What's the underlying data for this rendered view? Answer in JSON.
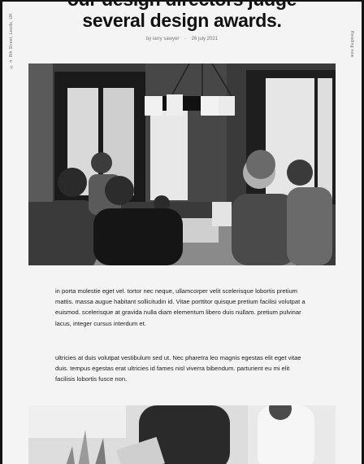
{
  "sidebar_left": "© n. 8th Street, Leeds, UK",
  "sidebar_right": "Reading now",
  "article": {
    "title_line1": "our design directors judge",
    "title_line2": "several design awards.",
    "byline_prefix": "by",
    "author": "larry sawyer",
    "separator": "-",
    "date": "26 july 2021",
    "paragraph1": "in porta molestie eget vel. tortor nec neque, ullamcorper velit scelerisque lobortis pretium mattis. massa augue habitant sollicitudin id. Vitae porttitor quisque pretium facilisi volutpat a euismod. scelerisque at gravida nulla diam elementum libero duis nullam. pretium pulvinar lacus, integer cursus interdum et.",
    "paragraph2": "ultricies at duis volutpat vestibulum sed ut. Nec pharetra leo magnis egestas elit eget vitae duis. tempus egestas erat ultricies id fames nisl viverra bibendum. parturient eu mi elit facilisis lobortis fusce non."
  },
  "images": {
    "hero": "team-meeting-photo",
    "second": "people-working-photo"
  },
  "colors": {
    "page_background": "#f4f4f4",
    "frame": "#141414",
    "text": "#1c1c1c",
    "muted": "#777777"
  }
}
